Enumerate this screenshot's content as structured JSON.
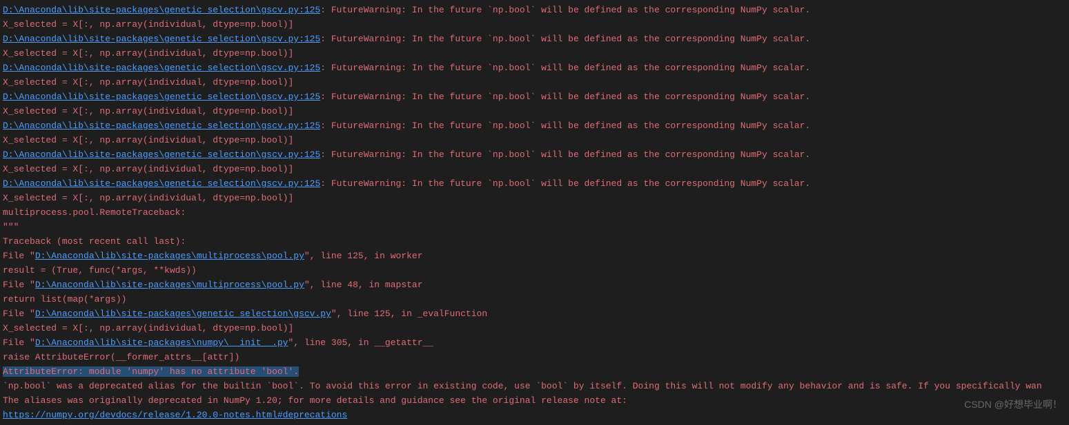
{
  "warnings": [
    {
      "path": "D:\\Anaconda\\lib\\site-packages\\genetic_selection\\gscv.py:125",
      "message": ": FutureWarning: In the future `np.bool` will be defined as the corresponding NumPy scalar.",
      "code": "  X_selected = X[:, np.array(individual, dtype=np.bool)]"
    },
    {
      "path": "D:\\Anaconda\\lib\\site-packages\\genetic_selection\\gscv.py:125",
      "message": ": FutureWarning: In the future `np.bool` will be defined as the corresponding NumPy scalar.",
      "code": "  X_selected = X[:, np.array(individual, dtype=np.bool)]"
    },
    {
      "path": "D:\\Anaconda\\lib\\site-packages\\genetic_selection\\gscv.py:125",
      "message": ": FutureWarning: In the future `np.bool` will be defined as the corresponding NumPy scalar.",
      "code": "  X_selected = X[:, np.array(individual, dtype=np.bool)]"
    },
    {
      "path": "D:\\Anaconda\\lib\\site-packages\\genetic_selection\\gscv.py:125",
      "message": ": FutureWarning: In the future `np.bool` will be defined as the corresponding NumPy scalar.",
      "code": "  X_selected = X[:, np.array(individual, dtype=np.bool)]"
    },
    {
      "path": "D:\\Anaconda\\lib\\site-packages\\genetic_selection\\gscv.py:125",
      "message": ": FutureWarning: In the future `np.bool` will be defined as the corresponding NumPy scalar.",
      "code": "  X_selected = X[:, np.array(individual, dtype=np.bool)]"
    },
    {
      "path": "D:\\Anaconda\\lib\\site-packages\\genetic_selection\\gscv.py:125",
      "message": ": FutureWarning: In the future `np.bool` will be defined as the corresponding NumPy scalar.",
      "code": "  X_selected = X[:, np.array(individual, dtype=np.bool)]"
    },
    {
      "path": "D:\\Anaconda\\lib\\site-packages\\genetic_selection\\gscv.py:125",
      "message": ": FutureWarning: In the future `np.bool` will be defined as the corresponding NumPy scalar.",
      "code": "  X_selected = X[:, np.array(individual, dtype=np.bool)]"
    }
  ],
  "remote_traceback": "multiprocess.pool.RemoteTraceback:",
  "triple_quote": "\"\"\"",
  "traceback_header": "Traceback (most recent call last):",
  "frames": [
    {
      "prefix": "  File \"",
      "path": "D:\\Anaconda\\lib\\site-packages\\multiprocess\\pool.py",
      "suffix": "\", line 125, in worker",
      "code": "    result = (True, func(*args, **kwds))"
    },
    {
      "prefix": "  File \"",
      "path": "D:\\Anaconda\\lib\\site-packages\\multiprocess\\pool.py",
      "suffix": "\", line 48, in mapstar",
      "code": "    return list(map(*args))"
    },
    {
      "prefix": "  File \"",
      "path": "D:\\Anaconda\\lib\\site-packages\\genetic_selection\\gscv.py",
      "suffix": "\", line 125, in _evalFunction",
      "code": "    X_selected = X[:, np.array(individual, dtype=np.bool)]"
    },
    {
      "prefix": "  File \"",
      "path": "D:\\Anaconda\\lib\\site-packages\\numpy\\__init__.py",
      "suffix": "\", line 305, in __getattr__",
      "code": "    raise AttributeError(__former_attrs__[attr])"
    }
  ],
  "error_line": "AttributeError: module 'numpy' has no attribute 'bool'.",
  "deprecation_msg1": "`np.bool` was a deprecated alias for the builtin `bool`. To avoid this error in existing code, use `bool` by itself. Doing this will not modify any behavior and is safe. If you specifically wan",
  "deprecation_msg2": "The aliases was originally deprecated in NumPy 1.20; for more details and guidance see the original release note at:",
  "deprecation_link": "https://numpy.org/devdocs/release/1.20.0-notes.html#deprecations",
  "watermark": "CSDN @好想毕业啊！"
}
